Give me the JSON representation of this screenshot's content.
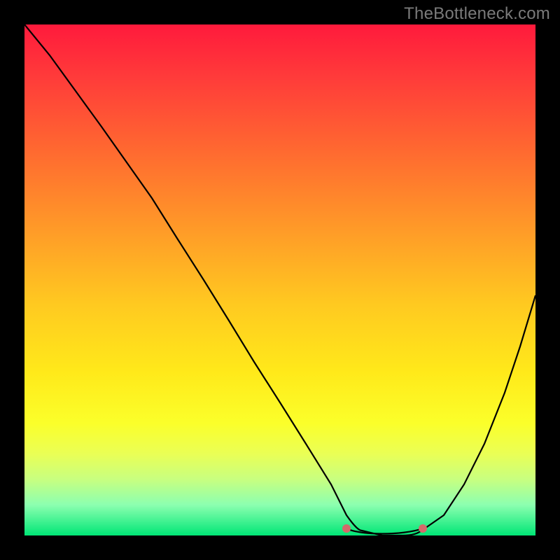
{
  "watermark": "TheBottleneck.com",
  "chart_data": {
    "type": "line",
    "title": "",
    "xlabel": "",
    "ylabel": "",
    "xlim": [
      0,
      100
    ],
    "ylim": [
      0,
      100
    ],
    "series": [
      {
        "name": "bottleneck-curve",
        "x": [
          0,
          5,
          10,
          15,
          20,
          25,
          30,
          35,
          40,
          45,
          50,
          55,
          60,
          63,
          66,
          70,
          74,
          78,
          82,
          86,
          90,
          94,
          97,
          100
        ],
        "values": [
          100,
          94,
          87,
          80,
          73,
          66,
          58,
          50,
          42,
          34,
          26,
          18,
          10,
          4,
          1,
          0,
          0,
          1,
          4,
          10,
          18,
          28,
          37,
          47
        ]
      }
    ],
    "annotations": [
      {
        "name": "optimal-range",
        "x_start": 63,
        "x_end": 78,
        "y": 0
      }
    ],
    "gradient_stops": [
      {
        "pos": 0.0,
        "color": "#ff1a3c"
      },
      {
        "pos": 0.55,
        "color": "#ffca20"
      },
      {
        "pos": 0.78,
        "color": "#fbff2a"
      },
      {
        "pos": 1.0,
        "color": "#00e676"
      }
    ]
  }
}
